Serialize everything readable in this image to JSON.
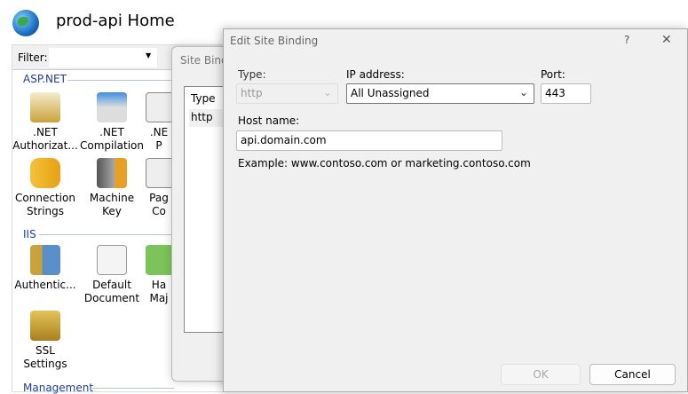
{
  "header": {
    "title": "prod-api Home",
    "icon": "globe-icon"
  },
  "filter": {
    "label": "Filter:",
    "value": ""
  },
  "groups": [
    {
      "name": "ASP.NET",
      "features": [
        ".NET Authorizat...",
        ".NET Compilation",
        ".NE P",
        "Connection Strings",
        "Machine Key",
        "Pag Co"
      ]
    },
    {
      "name": "IIS",
      "features": [
        "Authentic...",
        "Default Document",
        "Ha Maj",
        "SSL Settings"
      ]
    },
    {
      "name": "Management"
    }
  ],
  "site_bindings": {
    "title": "Site Bindi",
    "column": "Type",
    "rows": [
      "http"
    ]
  },
  "dialog": {
    "title": "Edit Site Binding",
    "help": "?",
    "close": "✕",
    "type_label": "Type:",
    "type_value": "http",
    "ip_label": "IP address:",
    "ip_value": "All Unassigned",
    "port_label": "Port:",
    "port_value": "443",
    "host_label": "Host name:",
    "host_value": "api.domain.com",
    "example": "Example: www.contoso.com or marketing.contoso.com",
    "ok": "OK",
    "cancel": "Cancel"
  }
}
